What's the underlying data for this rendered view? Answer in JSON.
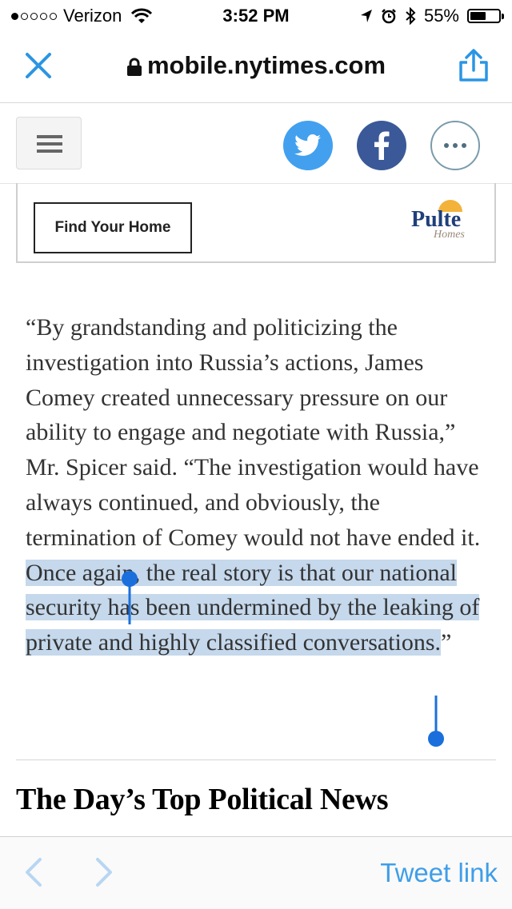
{
  "status_bar": {
    "carrier": "Verizon",
    "signal_dots_filled": 1,
    "signal_dots_total": 5,
    "time": "3:52 PM",
    "battery": "55%",
    "battery_level": 0.55
  },
  "browser": {
    "url": "mobile.nytimes.com"
  },
  "ad": {
    "button_label": "Find Your Home",
    "logo_text": "Pulte",
    "logo_subtext": "Homes"
  },
  "article": {
    "text_before_selection": "“By grandstanding and politicizing the investigation into Russia’s actions, James Comey created unnecessary pressure on our ability to engage and negotiate with Russia,” Mr. Spicer said. “The investigation would have always continued, and obviously, the termination of Comey would not have ended it. ",
    "selected_text": "Once again, the real story is that our national security has been undermined by the leaking of private and highly classified conversations.",
    "text_after_selection": "”"
  },
  "section": {
    "title": "The Day’s Top Political News"
  },
  "bottom_bar": {
    "tweet_link_label": "Tweet link"
  },
  "colors": {
    "accent_blue": "#3f9ee8",
    "twitter_blue": "#42a0ef",
    "facebook_blue": "#3b5998",
    "selection_highlight": "#c5d8ec",
    "selection_handle": "#1a6fdc"
  }
}
